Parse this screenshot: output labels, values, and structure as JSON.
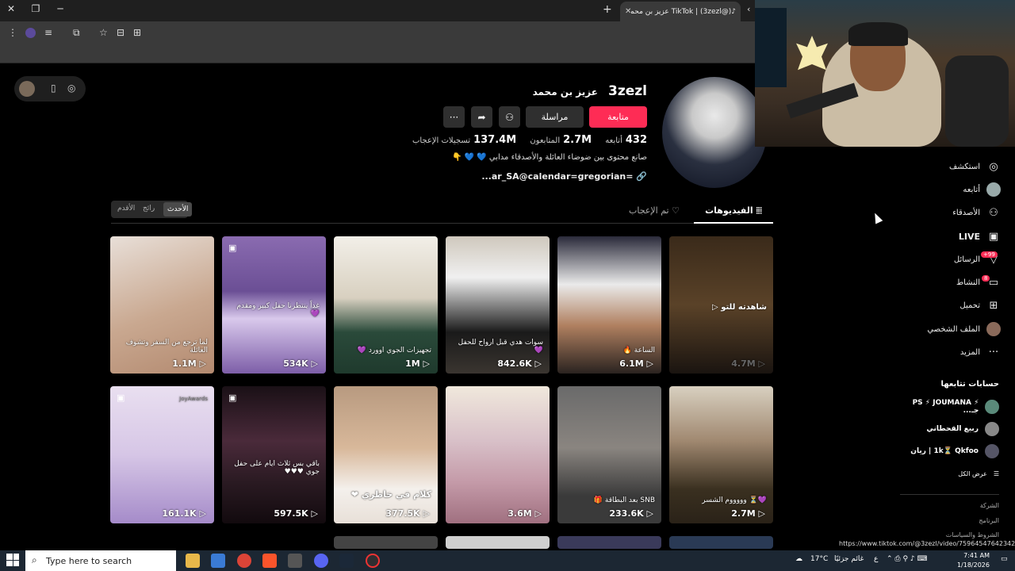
{
  "browser": {
    "tab_title": "TikTok | (3zezl@) عزيز بن محمد",
    "tab_close": "✕",
    "new_tab": "+",
    "window_controls": {
      "close": "✕",
      "restore": "❐",
      "minimize": "─"
    },
    "toolbar_icons": [
      "menu-dots-icon",
      "profile-icon",
      "playlist-icon",
      "extensions-icon",
      "bookmark-star-icon",
      "tab-search-icon",
      "split-view-icon"
    ]
  },
  "profile": {
    "username": "3zezl",
    "display_name": "عزيز بن محمد",
    "follow_label": "متابعة",
    "message_label": "مراسلة",
    "more_label": "···",
    "following_count": "432",
    "following_label": "أتابعه",
    "followers_count": "2.7M",
    "followers_label": "المتابعون",
    "likes_count": "137.4M",
    "likes_label": "تسجيلات الإعجاب",
    "bio": "صانع محتوى بين ضوضاء العائلة والأصدقاء مدابي 💙 💙 👇",
    "link": "=ar_SA@calendar=gregorian..."
  },
  "content_tabs": {
    "videos": "الفيديوهات",
    "liked": "تم الإعجاب"
  },
  "sort": {
    "latest": "الأحدث",
    "popular": "رائج",
    "oldest": "الأقدم"
  },
  "videos": [
    {
      "views": "1.1M",
      "overlay": "لما ترجع من السفر وتشوف العائلة",
      "pinned": false
    },
    {
      "views": "534K",
      "overlay": "غداً ينتظرنا حفل كبير ومقدم 💜",
      "pinned": true
    },
    {
      "views": "1M",
      "overlay": "تجهيزات الجوي اوورد 💜",
      "pinned": false
    },
    {
      "views": "842.6K",
      "overlay": "سوات هدي قبل ارواح للحفل 💜",
      "pinned": false
    },
    {
      "views": "6.1M",
      "overlay": "الساعة 🔥",
      "pinned": false
    },
    {
      "views": "4.7M",
      "overlay": "شاهدته للتو ▷",
      "pinned": false
    },
    {
      "views": "161.1K",
      "overlay": "JoyAwards",
      "pinned": true
    },
    {
      "views": "597.5K",
      "overlay": "باقي بس ثلاث ايام على حفل جوي ♥♥♥",
      "pinned": true
    },
    {
      "views": "377.5K",
      "overlay": "كلام في خاطري ❤",
      "pinned": false
    },
    {
      "views": "3.6M",
      "overlay": "",
      "pinned": false
    },
    {
      "views": "233.6K",
      "overlay": "SNB بعد البطاقة 🎁",
      "pinned": false
    },
    {
      "views": "2.7M",
      "overlay": "💜⏳ وووووم الشسر",
      "pinned": false
    }
  ],
  "sidebar": {
    "nav": [
      {
        "label": "استكشف",
        "icon": "compass-icon"
      },
      {
        "label": "أتابعه",
        "icon": "following-avatar-icon"
      },
      {
        "label": "الأصدقاء",
        "icon": "friends-icon"
      },
      {
        "label": "LIVE",
        "icon": "live-tv-icon"
      },
      {
        "label": "الرسائل",
        "icon": "inbox-icon",
        "badge": "+99"
      },
      {
        "label": "النشاط",
        "icon": "activity-icon",
        "badge": "8"
      },
      {
        "label": "تحميل",
        "icon": "upload-icon"
      },
      {
        "label": "الملف الشخصي",
        "icon": "profile-avatar-icon"
      },
      {
        "label": "المزيد",
        "icon": "more-dots-icon"
      }
    ],
    "following_header": "حسابات تتابعها",
    "following_accounts": [
      "⚡ PS ⚡ JOUMANA جـ...",
      "ربيع القحطاني",
      "1k⏳ Qkfoo | ريان"
    ],
    "see_all": "عرض الكل",
    "footer": [
      "الشركة",
      "البرنامج",
      "الشروط والسياسات"
    ]
  },
  "status_url": "https://www.tiktok.com/@3zezl/video/7596454764234280212",
  "taskbar": {
    "search_placeholder": "Type here to search",
    "weather_temp": "17°C",
    "weather_text": "غائم جزئيًا",
    "lang": "ع",
    "time": "7:41 AM",
    "date": "1/18/2026"
  },
  "colors": {
    "accent": "#fe2c55",
    "background": "#000000",
    "taskbar": "#1c2733"
  }
}
